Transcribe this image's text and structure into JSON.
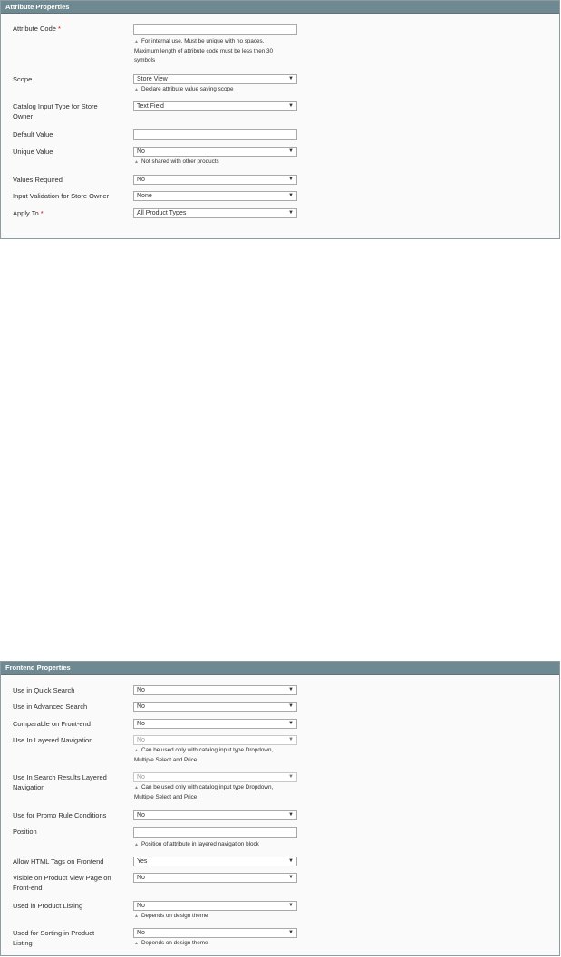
{
  "attr": {
    "title": "Attribute Properties",
    "code_label": "Attribute Code",
    "req_mark": "*",
    "code_value": "",
    "code_note_1": "For internal use. Must be unique with no spaces.",
    "code_note_2": "Maximum length of attribute code must be less then 30",
    "code_note_3": "symbols",
    "scope_label": "Scope",
    "scope_value": "Store View",
    "scope_note": "Declare attribute value saving scope",
    "input_type_label_1": "Catalog Input Type for Store",
    "input_type_label_2": "Owner",
    "input_type_value": "Text Field",
    "default_label": "Default Value",
    "default_value": "",
    "unique_label": "Unique Value",
    "unique_value": "No",
    "unique_note": "Not shared with other products",
    "required_label": "Values Required",
    "required_value": "No",
    "validation_label": "Input Validation for Store Owner",
    "validation_value": "None",
    "apply_label": "Apply To",
    "apply_value": "All Product Types"
  },
  "front": {
    "title": "Frontend Properties",
    "quick_label": "Use in Quick Search",
    "quick_value": "No",
    "advanced_label": "Use in Advanced Search",
    "advanced_value": "No",
    "compare_label": "Comparable on Front-end",
    "compare_value": "No",
    "layered_label": "Use In Layered Navigation",
    "layered_value": "No",
    "layered_note_1": "Can be used only with catalog input type Dropdown,",
    "layered_note_2": "Multiple Select and Price",
    "search_layered_label_1": "Use In Search Results Layered",
    "search_layered_label_2": "Navigation",
    "search_layered_value": "No",
    "search_layered_note_1": "Can be used only with catalog input type Dropdown,",
    "search_layered_note_2": "Multiple Select and Price",
    "promo_label": "Use for Promo Rule Conditions",
    "promo_value": "No",
    "position_label": "Position",
    "position_value": "",
    "position_note": "Position of attribute in layered navigation block",
    "html_label": "Allow HTML Tags on Frontend",
    "html_value": "Yes",
    "visible_label_1": "Visible on Product View Page on",
    "visible_label_2": "Front-end",
    "visible_value": "No",
    "listing_label": "Used in Product Listing",
    "listing_value": "No",
    "listing_note": "Depends on design theme",
    "sorting_label_1": "Used for Sorting in Product",
    "sorting_label_2": "Listing",
    "sorting_value": "No",
    "sorting_note": "Depends on design theme"
  },
  "icons": {
    "dropdown": "▼",
    "note": "▲"
  }
}
